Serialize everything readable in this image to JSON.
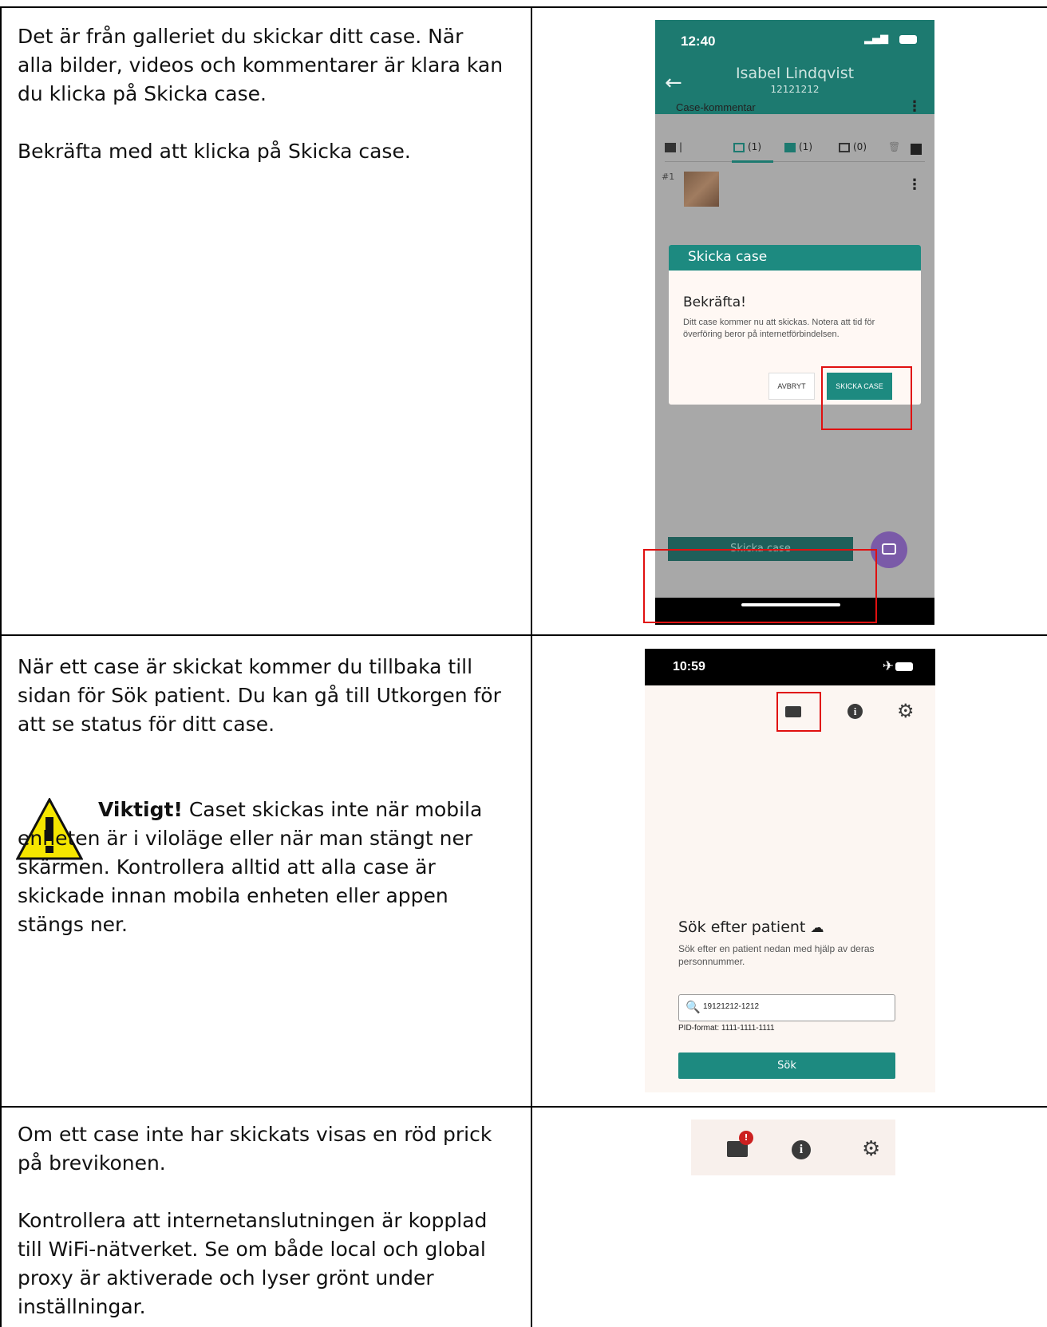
{
  "rows": [
    {
      "paragraphs": [
        "Det är från galleriet du skickar ditt case. När alla bilder, videos och kommentarer är klara kan du klicka på Skicka case.",
        "Bekräfta med att klicka på Skicka case."
      ]
    },
    {
      "paragraphs": [
        "När ett case är skickat kommer du tillbaka till sidan för Sök patient. Du kan gå till Utkorgen för att se status för ditt case."
      ],
      "warning": {
        "bold": "Viktigt!",
        "text": " Caset skickas inte när mobila enheten är i viloläge eller när man stängt ner skärmen. Kontrollera alltid att alla case är skickade innan mobila enheten eller appen stängs ner.",
        "icon": "warning-triangle-icon"
      }
    },
    {
      "paragraphs": [
        "Om ett case inte har skickats visas en röd prick på brevikonen.",
        "Kontrollera att internetanslutningen är kopplad till WiFi-nätverket. Se om både local och global proxy är aktiverade och lyser grönt under inställningar."
      ]
    }
  ],
  "phone1": {
    "time": "12:40",
    "patient_name": "Isabel Lindqvist",
    "patient_id": "12121212",
    "comment_label": "Case-kommentar",
    "tabs": [
      "(1)",
      "(1)",
      "(0)"
    ],
    "item_number": "#1",
    "dialog": {
      "header": "Skicka case",
      "title": "Bekräfta!",
      "body": "Ditt case kommer nu att skickas. Notera att tid för överföring beror på internetförbindelsen.",
      "cancel": "AVBRYT",
      "confirm": "SKICKA CASE"
    },
    "send_button": "Skicka case"
  },
  "phone2": {
    "time": "10:59",
    "title": "Sök efter patient",
    "subtitle": "Sök efter en patient nedan med hjälp av deras personnummer.",
    "search_value": "19121212-1212",
    "pid_format": "PID-format: 1111-1111-1111",
    "search_button": "Sök"
  },
  "icon_strip": {
    "badge": "!"
  },
  "colors": {
    "teal": "#1d7a70",
    "highlight": "#e01010",
    "badge": "#cc2020",
    "fab": "#7a5aa8"
  }
}
